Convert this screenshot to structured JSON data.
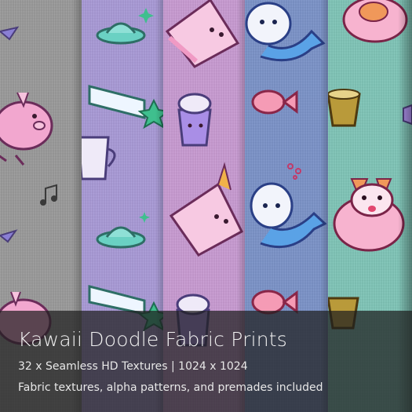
{
  "product": {
    "title": "Kawaii Doodle Fabric Prints",
    "subtitle": "32 x Seamless HD Textures | 1024 x 1024",
    "tagline": "Fabric textures, alpha patterns, and premades included"
  },
  "swatches": [
    {
      "name": "gray",
      "color": "#9a9a9a"
    },
    {
      "name": "lavender",
      "color": "#a99ad8"
    },
    {
      "name": "pink",
      "color": "#c99bd3"
    },
    {
      "name": "blue",
      "color": "#7b93c9"
    },
    {
      "name": "mint",
      "color": "#7fc6b8"
    }
  ],
  "colors": {
    "outline": "#6b2c5a",
    "pink_fill": "#f2a7cf",
    "mint_fill": "#6ad1c3",
    "purple_fill": "#a98ee6",
    "gold": "#c8a64a"
  },
  "doodles": [
    "unicorn-pig-doodle",
    "music-note-doodle",
    "tea-cup-doodle",
    "ufo-doodle",
    "shooting-star-doodle",
    "cake-slice-doodle",
    "boba-drink-doodle",
    "seal-mermaid-doodle",
    "fish-doodle",
    "corgi-doodle",
    "pet-bowl-doodle"
  ]
}
